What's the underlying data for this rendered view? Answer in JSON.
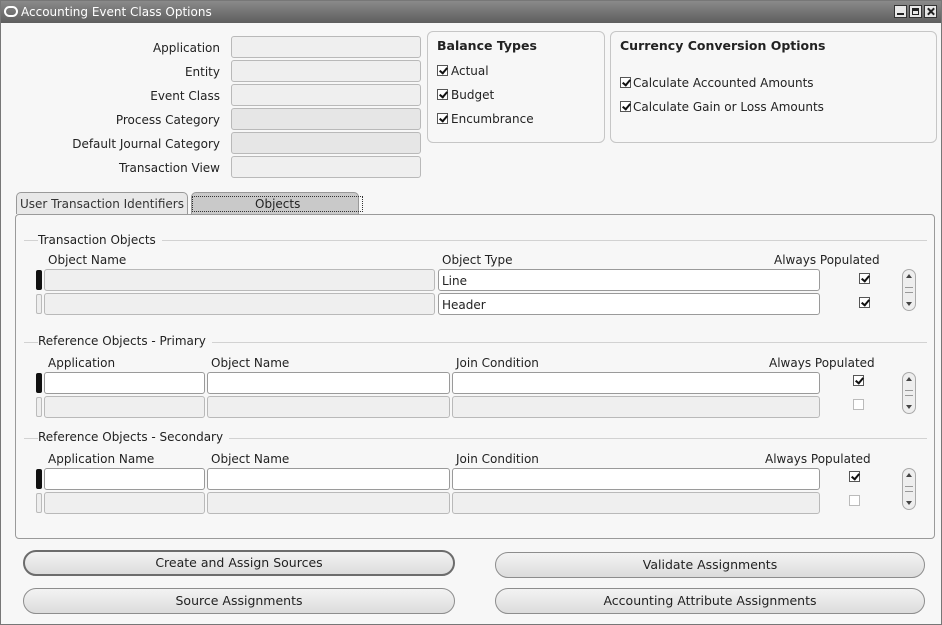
{
  "window": {
    "title": "Accounting Event Class Options"
  },
  "header_fields": [
    {
      "label": "Application",
      "value": ""
    },
    {
      "label": "Entity",
      "value": ""
    },
    {
      "label": "Event Class",
      "value": ""
    },
    {
      "label": "Process Category",
      "value": ""
    },
    {
      "label": "Default Journal Category",
      "value": ""
    },
    {
      "label": "Transaction View",
      "value": ""
    }
  ],
  "balance_types": {
    "title": "Balance Types",
    "items": [
      {
        "label": "Actual",
        "checked": true
      },
      {
        "label": "Budget",
        "checked": true
      },
      {
        "label": "Encumbrance",
        "checked": true
      }
    ]
  },
  "currency_conversion": {
    "title": "Currency Conversion Options",
    "items": [
      {
        "label": "Calculate Accounted Amounts",
        "checked": true
      },
      {
        "label": "Calculate Gain or Loss Amounts",
        "checked": true
      }
    ]
  },
  "tabs": [
    {
      "label": "User Transaction Identifiers",
      "active": false
    },
    {
      "label": "Objects",
      "active": true
    }
  ],
  "transaction_objects": {
    "title": "Transaction Objects",
    "columns": [
      "Object Name",
      "Object Type",
      "Always Populated"
    ],
    "rows": [
      {
        "object_name": "",
        "object_type": "Line",
        "always_populated": true
      },
      {
        "object_name": "",
        "object_type": "Header",
        "always_populated": true
      }
    ]
  },
  "reference_primary": {
    "title": "Reference Objects - Primary",
    "columns": [
      "Application",
      "Object Name",
      "Join Condition",
      "Always Populated"
    ],
    "rows": [
      {
        "application": "",
        "object_name": "",
        "join_condition": "",
        "always_populated": true
      },
      {
        "application": "",
        "object_name": "",
        "join_condition": "",
        "always_populated": false
      }
    ]
  },
  "reference_secondary": {
    "title": "Reference Objects - Secondary",
    "columns": [
      "Application Name",
      "Object Name",
      "Join Condition",
      "Always Populated"
    ],
    "rows": [
      {
        "application": "",
        "object_name": "",
        "join_condition": "",
        "always_populated": true
      },
      {
        "application": "",
        "object_name": "",
        "join_condition": "",
        "always_populated": false
      }
    ]
  },
  "buttons": {
    "create_assign": "Create and Assign Sources",
    "validate": "Validate Assignments",
    "source_assignments": "Source Assignments",
    "accounting_attribute": "Accounting Attribute Assignments"
  }
}
